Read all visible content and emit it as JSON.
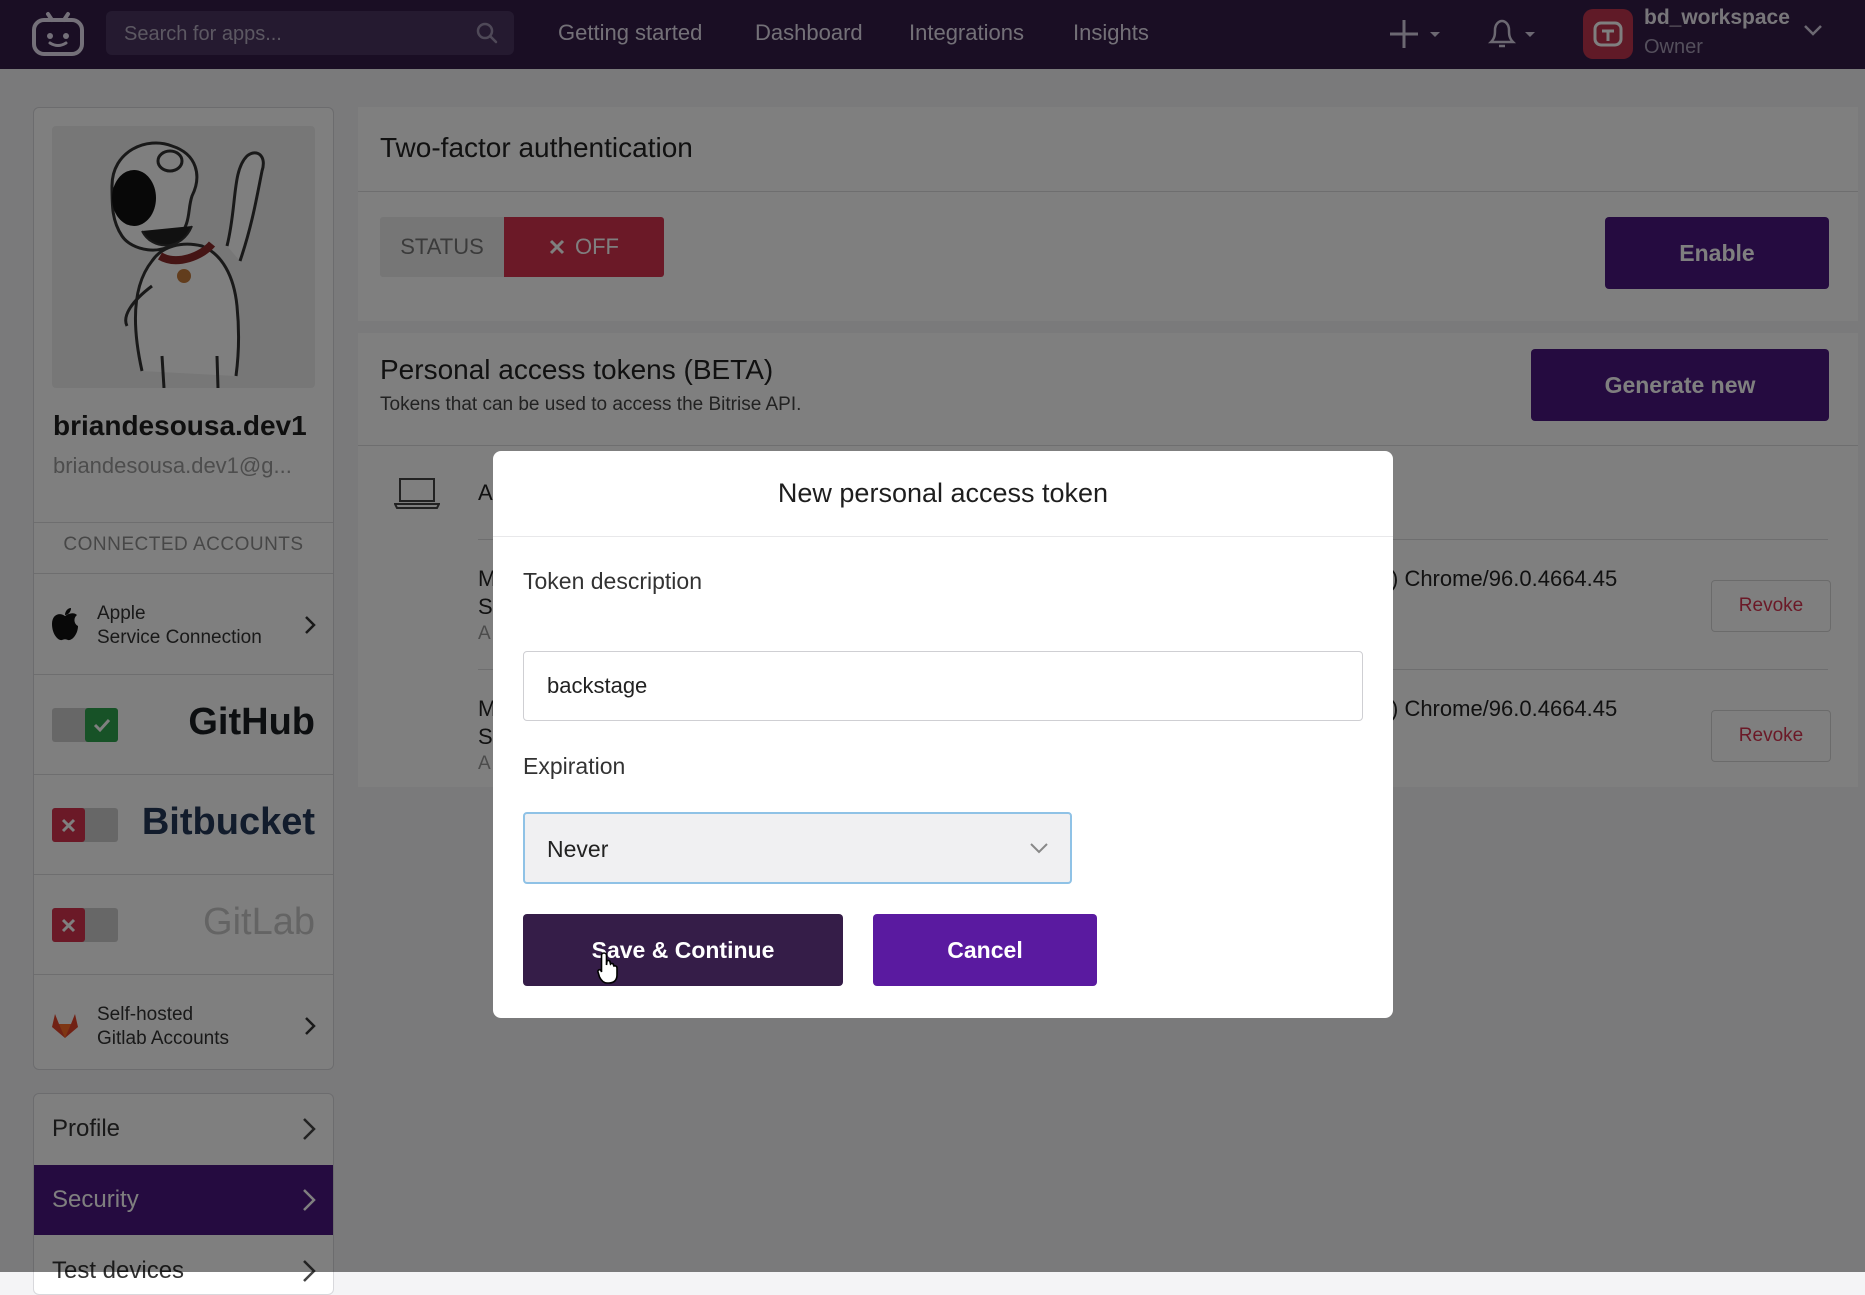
{
  "topbar": {
    "search_placeholder": "Search for apps...",
    "nav": [
      "Getting started",
      "Dashboard",
      "Integrations",
      "Insights"
    ],
    "workspace_name": "bd_workspace",
    "workspace_role": "Owner"
  },
  "sidebar": {
    "username": "briandesousa.dev1",
    "email": "briandesousa.dev1@g...",
    "connected_title": "CONNECTED ACCOUNTS",
    "apple_line1": "Apple",
    "apple_line2": "Service Connection",
    "github": "GitHub",
    "bitbucket": "Bitbucket",
    "gitlab": "GitLab",
    "selfhosted_line1": "Self-hosted",
    "selfhosted_line2": "Gitlab Accounts",
    "menu": [
      "Profile",
      "Security",
      "Test devices"
    ]
  },
  "main": {
    "two_factor_title": "Two-factor authentication",
    "status_label": "STATUS",
    "status_value": "OFF",
    "enable_button": "Enable",
    "tokens_title": "Personal access tokens (BETA)",
    "tokens_subtitle": "Tokens that can be used to access the Bitrise API.",
    "generate_button": "Generate new",
    "sessions_header_partial": "A",
    "sessions": [
      {
        "left_l1": "M",
        "left_l2": "S",
        "left_l3": "A",
        "right": ") Chrome/96.0.4664.45",
        "revoke": "Revoke"
      },
      {
        "left_l1": "M",
        "left_l2": "S",
        "left_l3": "A",
        "right": ") Chrome/96.0.4664.45",
        "revoke": "Revoke"
      }
    ]
  },
  "modal": {
    "title": "New personal access token",
    "description_label": "Token description",
    "description_value": "backstage",
    "expiration_label": "Expiration",
    "expiration_value": "Never",
    "save_button": "Save & Continue",
    "cancel_button": "Cancel"
  },
  "colors": {
    "topbar": "#351d48",
    "primary": "#4b1781",
    "danger": "#d6324e",
    "github_green": "#2ea44f"
  }
}
